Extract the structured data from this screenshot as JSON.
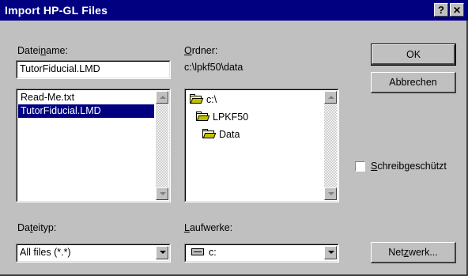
{
  "window": {
    "title": "Import HP-GL Files",
    "help_label": "?",
    "close_label": "✕"
  },
  "filename": {
    "label_pre": "Datei",
    "label_u": "n",
    "label_post": "ame:",
    "value": "TutorFiducial.LMD",
    "files": [
      {
        "name": "Read-Me.txt",
        "selected": false
      },
      {
        "name": "TutorFiducial.LMD",
        "selected": true
      }
    ]
  },
  "folder": {
    "label_u": "O",
    "label_post": "rdner:",
    "path": "c:\\lpkf50\\data",
    "tree": [
      {
        "name": "c:\\",
        "icon": "open-folder-icon"
      },
      {
        "name": "LPKF50",
        "icon": "open-folder-icon"
      },
      {
        "name": "Data",
        "icon": "open-folder-icon"
      }
    ]
  },
  "buttons": {
    "ok": "OK",
    "cancel": "Abbrechen",
    "network_pre": "Net",
    "network_u": "z",
    "network_post": "werk..."
  },
  "readonly": {
    "label_u": "S",
    "label_post": "chreibgeschützt",
    "checked": false
  },
  "filetype": {
    "label_pre": "Da",
    "label_u": "t",
    "label_post": "eityp:",
    "value": "All files (*.*)"
  },
  "drives": {
    "label_u": "L",
    "label_post": "aufwerke:",
    "value": "c:",
    "icon": "drive-icon"
  }
}
